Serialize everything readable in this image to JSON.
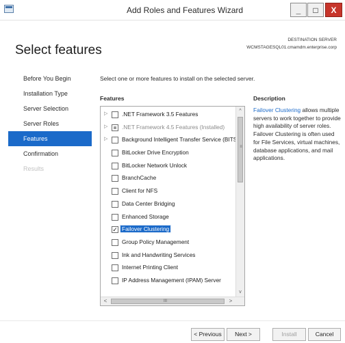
{
  "window": {
    "title": "Add Roles and Features Wizard",
    "minimize_glyph": "_",
    "maximize_glyph": "□",
    "close_glyph": "X"
  },
  "header": {
    "page_title": "Select features",
    "destination_label": "DESTINATION SERVER",
    "destination_value": "WCMSTAGESQL01.cmamdm.enterprise.corp"
  },
  "nav": {
    "items": [
      {
        "label": "Before You Begin",
        "state": "normal"
      },
      {
        "label": "Installation Type",
        "state": "normal"
      },
      {
        "label": "Server Selection",
        "state": "normal"
      },
      {
        "label": "Server Roles",
        "state": "normal"
      },
      {
        "label": "Features",
        "state": "active"
      },
      {
        "label": "Confirmation",
        "state": "normal"
      },
      {
        "label": "Results",
        "state": "disabled"
      }
    ]
  },
  "main": {
    "instruction": "Select one or more features to install on the selected server.",
    "features_heading": "Features",
    "description_heading": "Description",
    "features": [
      {
        "label": ".NET Framework 3.5 Features",
        "expandable": true,
        "check": "unchecked"
      },
      {
        "label": ".NET Framework 4.5 Features (Installed)",
        "expandable": true,
        "check": "partial",
        "installed": true
      },
      {
        "label": "Background Intelligent Transfer Service (BITS)",
        "expandable": true,
        "check": "unchecked"
      },
      {
        "label": "BitLocker Drive Encryption",
        "expandable": false,
        "check": "unchecked"
      },
      {
        "label": "BitLocker Network Unlock",
        "expandable": false,
        "check": "unchecked"
      },
      {
        "label": "BranchCache",
        "expandable": false,
        "check": "unchecked"
      },
      {
        "label": "Client for NFS",
        "expandable": false,
        "check": "unchecked"
      },
      {
        "label": "Data Center Bridging",
        "expandable": false,
        "check": "unchecked"
      },
      {
        "label": "Enhanced Storage",
        "expandable": false,
        "check": "unchecked"
      },
      {
        "label": "Failover Clustering",
        "expandable": false,
        "check": "checked",
        "selected": true
      },
      {
        "label": "Group Policy Management",
        "expandable": false,
        "check": "unchecked"
      },
      {
        "label": "Ink and Handwriting Services",
        "expandable": false,
        "check": "unchecked"
      },
      {
        "label": "Internet Printing Client",
        "expandable": false,
        "check": "unchecked"
      },
      {
        "label": "IP Address Management (IPAM) Server",
        "expandable": false,
        "check": "unchecked"
      }
    ],
    "description": {
      "link": "Failover Clustering",
      "text": " allows multiple servers to work together to provide high availability of server roles. Failover Clustering is often used for File Services, virtual machines, database applications, and mail applications."
    }
  },
  "scroll": {
    "up_glyph": "^",
    "down_glyph": "v",
    "left_glyph": "<",
    "right_glyph": ">",
    "vertical_grip": "≡",
    "horizontal_grip": "III"
  },
  "footer": {
    "previous": "< Previous",
    "next": "Next >",
    "install": "Install",
    "cancel": "Cancel"
  },
  "colors": {
    "accent": "#1b6ac9",
    "close_button": "#c7352b",
    "disabled_text": "#c2c2c2"
  }
}
